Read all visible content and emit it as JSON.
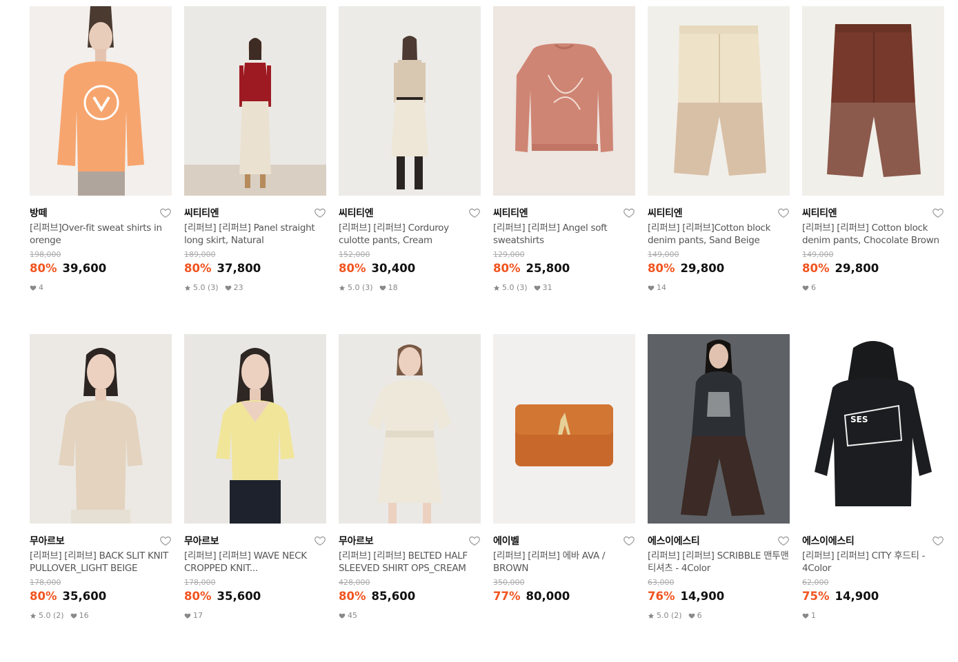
{
  "colors": {
    "discount": "#f1541f",
    "strike": "#aaaaaa",
    "text": "#111111",
    "meta": "#888888"
  },
  "products": [
    {
      "brand": "방떼",
      "title": "[리퍼브]Over-fit sweat shirts in orenge",
      "original_price": "198,000",
      "discount": "80%",
      "price": "39,600",
      "rating": "",
      "likes": "4",
      "image": "orange-sweatshirt-model"
    },
    {
      "brand": "씨티티엔",
      "title": "[리퍼브] [리퍼브] Panel straight long skirt, Natural",
      "original_price": "189,000",
      "discount": "80%",
      "price": "37,800",
      "rating": "5.0 (3)",
      "likes": "23",
      "image": "red-top-long-skirt-model"
    },
    {
      "brand": "씨티티엔",
      "title": "[리퍼브] [리퍼브] Corduroy culotte pants, Cream",
      "original_price": "152,000",
      "discount": "80%",
      "price": "30,400",
      "rating": "5.0 (3)",
      "likes": "18",
      "image": "cream-culotte-model"
    },
    {
      "brand": "씨티티엔",
      "title": "[리퍼브] [리퍼브] Angel soft sweatshirts",
      "original_price": "129,000",
      "discount": "80%",
      "price": "25,800",
      "rating": "5.0 (3)",
      "likes": "31",
      "image": "pink-sweatshirt-flat"
    },
    {
      "brand": "씨티티엔",
      "title": "[리퍼브] [리퍼브]Cotton block denim pants, Sand Beige",
      "original_price": "149,000",
      "discount": "80%",
      "price": "29,800",
      "rating": "",
      "likes": "14",
      "image": "beige-block-pants"
    },
    {
      "brand": "씨티티엔",
      "title": "[리퍼브] [리퍼브] Cotton block denim pants, Chocolate Brown",
      "original_price": "149,000",
      "discount": "80%",
      "price": "29,800",
      "rating": "",
      "likes": "6",
      "image": "brown-block-pants"
    },
    {
      "brand": "무아르보",
      "title": "[리퍼브] [리퍼브] BACK SLIT KNIT PULLOVER_LIGHT BEIGE",
      "original_price": "178,000",
      "discount": "80%",
      "price": "35,600",
      "rating": "5.0 (2)",
      "likes": "16",
      "image": "beige-knit-model"
    },
    {
      "brand": "무아르보",
      "title": "[리퍼브] [리퍼브] WAVE NECK CROPPED KNIT...",
      "original_price": "178,000",
      "discount": "80%",
      "price": "35,600",
      "rating": "",
      "likes": "17",
      "image": "yellow-knit-model"
    },
    {
      "brand": "무아르보",
      "title": "[리퍼브] [리퍼브] BELTED HALF SLEEVED SHIRT OPS_CREAM",
      "original_price": "428,000",
      "discount": "80%",
      "price": "85,600",
      "rating": "",
      "likes": "45",
      "image": "cream-shirt-dress-model"
    },
    {
      "brand": "에이벨",
      "title": "[리퍼브] [리퍼브] 에바 AVA / BROWN",
      "original_price": "350,000",
      "discount": "77%",
      "price": "80,000",
      "rating": "",
      "likes": "",
      "image": "brown-bag"
    },
    {
      "brand": "에스이에스티",
      "title": "[리퍼브] [리퍼브] SCRIBBLE 맨투맨 티셔츠 - 4Color",
      "original_price": "63,000",
      "discount": "76%",
      "price": "14,900",
      "rating": "5.0 (2)",
      "likes": "6",
      "image": "dark-sweatshirt-model"
    },
    {
      "brand": "에스이에스티",
      "title": "[리퍼브] [리퍼브] CITY 후드티 - 4Color",
      "original_price": "62,000",
      "discount": "75%",
      "price": "14,900",
      "rating": "",
      "likes": "1",
      "image": "black-hoodie-flat"
    }
  ]
}
